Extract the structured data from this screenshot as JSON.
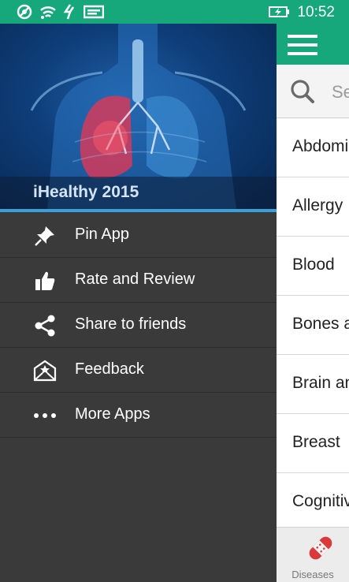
{
  "status_bar": {
    "time": "10:52",
    "icons": [
      "data-sense-icon",
      "wifi-icon",
      "nfc-icon",
      "message-icon",
      "battery-charging-icon"
    ]
  },
  "main_page": {
    "search_placeholder": "Se",
    "categories": [
      "Abdomi",
      "Allergy",
      "Blood",
      "Bones a",
      "Brain an",
      "Breast",
      "Cognitiv"
    ],
    "bottom_tab": {
      "label": "Diseases",
      "icon": "bandage-icon"
    }
  },
  "drawer": {
    "header_title": "iHealthy 2015",
    "menu": [
      {
        "label": "Pin App",
        "icon": "pin-icon"
      },
      {
        "label": "Rate and Review",
        "icon": "thumbs-up-icon"
      },
      {
        "label": "Share to friends",
        "icon": "share-icon"
      },
      {
        "label": "Feedback",
        "icon": "mail-icon"
      },
      {
        "label": "More Apps",
        "icon": "more-icon"
      }
    ]
  },
  "colors": {
    "accent_green": "#16a87a",
    "drawer_bg": "#3a3a3a",
    "accent_blue": "#3ca0d8",
    "tab_red": "#d93a3a"
  }
}
